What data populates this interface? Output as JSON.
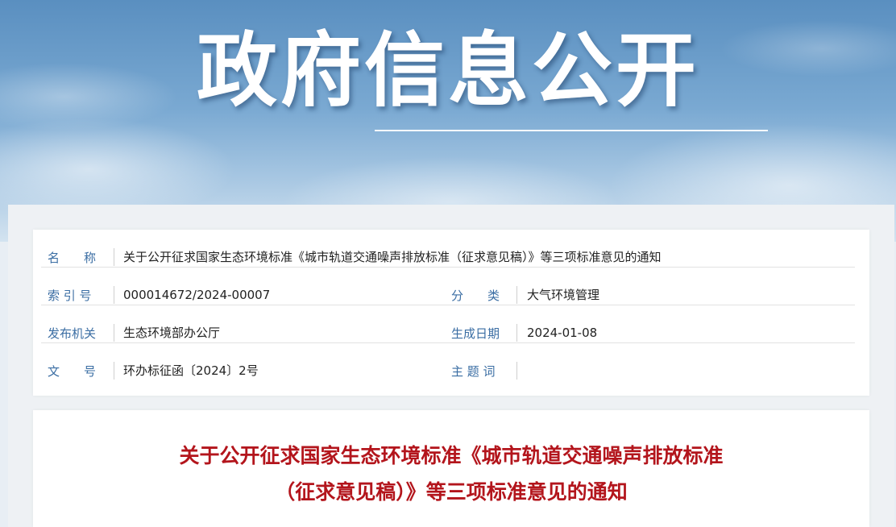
{
  "banner": {
    "title": "政府信息公开"
  },
  "info": {
    "name": {
      "label": "名　　称",
      "value": "关于公开征求国家生态环境标准《城市轨道交通噪声排放标准（征求意见稿）》等三项标准意见的通知"
    },
    "index_no": {
      "label": "索 引 号",
      "value": "000014672/2024-00007"
    },
    "category": {
      "label": "分　　类",
      "value": "大气环境管理"
    },
    "publisher": {
      "label": "发布机关",
      "value": "生态环境部办公厅"
    },
    "date": {
      "label": "生成日期",
      "value": "2024-01-08"
    },
    "doc_no": {
      "label": "文　　号",
      "value": "环办标征函〔2024〕2号"
    },
    "keywords": {
      "label": "主 题 词",
      "value": ""
    }
  },
  "document": {
    "title_line1": "关于公开征求国家生态环境标准《城市轨道交通噪声排放标准",
    "title_line2": "（征求意见稿）》等三项标准意见的通知"
  },
  "colors": {
    "label": "#3a6da3",
    "title_red": "#b3151c",
    "banner_blue": "#5a8fc0"
  }
}
